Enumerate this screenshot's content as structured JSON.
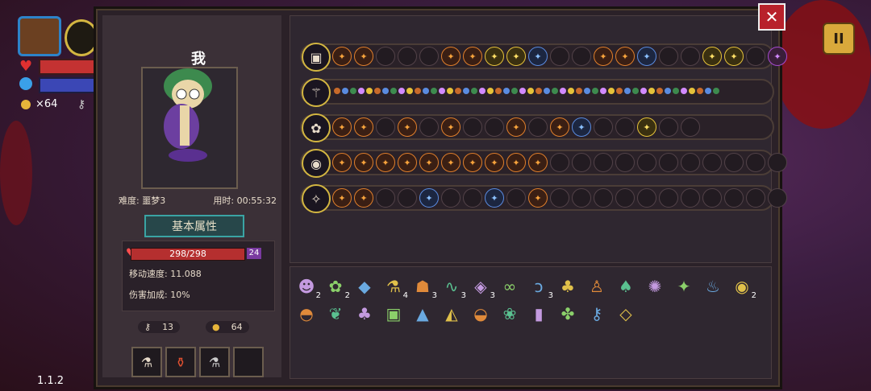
{
  "hud": {
    "coins_text": "×64",
    "version": "1.1.2"
  },
  "panel": {
    "close_label": "✕",
    "character_label": "我",
    "difficulty": "难度: 噩梦3",
    "time_used": "用时: 00:55:32",
    "attr_title": "基本属性",
    "hp_text": "298/298",
    "shield_value": "24",
    "move_speed": "移动速度: 11.088",
    "damage_bonus": "伤害加成: 10%",
    "keys_count": "13",
    "gold_count": "64"
  },
  "skill_rows": [
    {
      "icon": "chest",
      "cells": [
        "f",
        "f",
        "",
        "",
        "",
        "f",
        "f",
        "g",
        "g",
        "b",
        "",
        "",
        "f",
        "f",
        "b",
        "",
        "",
        "g",
        "g",
        "",
        "p"
      ]
    },
    {
      "icon": "staff",
      "tiny": true
    },
    {
      "icon": "flower",
      "cells": [
        "f",
        "f",
        "",
        "f",
        "",
        "f",
        "",
        "",
        "f",
        "",
        "f",
        "b",
        "",
        "",
        "g",
        "",
        ""
      ]
    },
    {
      "icon": "orb",
      "cells": [
        "f",
        "f",
        "f",
        "f",
        "f",
        "f",
        "f",
        "f",
        "f",
        "f",
        "",
        "",
        "",
        "",
        "",
        "",
        "",
        "",
        "",
        "",
        ""
      ]
    },
    {
      "icon": "wand",
      "cells": [
        "f",
        "f",
        "",
        "",
        "b",
        "",
        "",
        "b",
        "",
        "f",
        "",
        "",
        "",
        "",
        "",
        "",
        "",
        "",
        "",
        "",
        ""
      ]
    }
  ],
  "items": [
    {
      "g": "☻",
      "c": "2"
    },
    {
      "g": "✿",
      "c": "2"
    },
    {
      "g": "◆",
      "c": ""
    },
    {
      "g": "⚗",
      "c": "4"
    },
    {
      "g": "☗",
      "c": "3"
    },
    {
      "g": "∿",
      "c": "3"
    },
    {
      "g": "◈",
      "c": "3"
    },
    {
      "g": "∞",
      "c": ""
    },
    {
      "g": "ↄ",
      "c": "3"
    },
    {
      "g": "♣",
      "c": ""
    },
    {
      "g": "♙",
      "c": ""
    },
    {
      "g": "♠",
      "c": ""
    },
    {
      "g": "✺",
      "c": ""
    },
    {
      "g": "✦",
      "c": ""
    },
    {
      "g": "♨",
      "c": ""
    },
    {
      "g": "◉",
      "c": "2"
    },
    {
      "g": "◓",
      "c": ""
    },
    {
      "g": "❦",
      "c": ""
    },
    {
      "g": "♣",
      "c": ""
    },
    {
      "g": "▣",
      "c": ""
    },
    {
      "g": "▲",
      "c": ""
    },
    {
      "g": "◭",
      "c": ""
    },
    {
      "g": "◒",
      "c": ""
    },
    {
      "g": "❀",
      "c": ""
    },
    {
      "g": "▮",
      "c": ""
    },
    {
      "g": "✤",
      "c": ""
    },
    {
      "g": "⚷",
      "c": ""
    },
    {
      "g": "◇",
      "c": ""
    }
  ],
  "pause_label": "II"
}
